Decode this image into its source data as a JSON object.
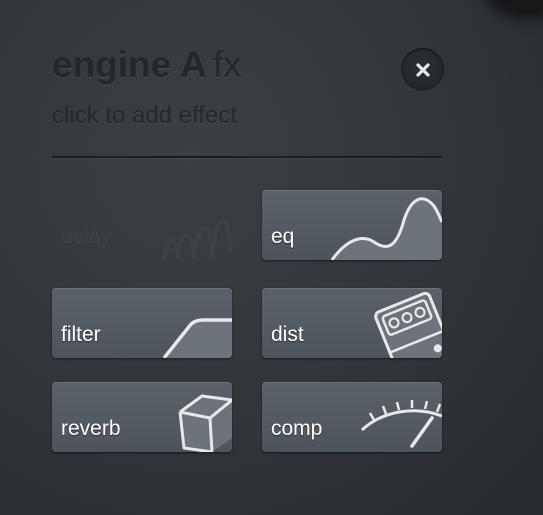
{
  "header": {
    "title_bold": "engine A",
    "title_light": "fx",
    "subtitle": "click to add effect"
  },
  "close_button": {
    "icon": "close-icon"
  },
  "effects": [
    {
      "label": "delay",
      "enabled": false,
      "icon": "delay-wave-icon"
    },
    {
      "label": "eq",
      "enabled": true,
      "icon": "eq-curve-icon"
    },
    {
      "label": "filter",
      "enabled": true,
      "icon": "filter-curve-icon"
    },
    {
      "label": "dist",
      "enabled": true,
      "icon": "distortion-pedal-icon"
    },
    {
      "label": "reverb",
      "enabled": true,
      "icon": "reverb-cube-icon"
    },
    {
      "label": "comp",
      "enabled": true,
      "icon": "compressor-meter-icon"
    }
  ],
  "colors": {
    "tile": "#555c63",
    "text": "#ffffff",
    "header_text": "#24282c",
    "background": "#33383c"
  }
}
